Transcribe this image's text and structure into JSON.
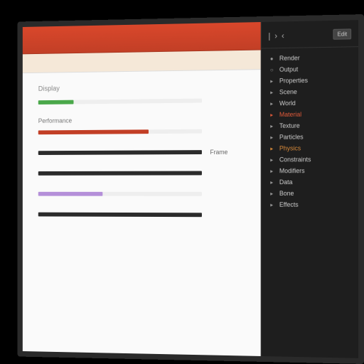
{
  "header": {
    "title": ""
  },
  "content": {
    "section1_label": "Display",
    "section2_label": "Performance",
    "rows": [
      {
        "caption": "",
        "fill_pct": 22,
        "color": "#4aa84a",
        "label": ""
      },
      {
        "caption": "",
        "fill_pct": 68,
        "color": "#c23f26",
        "label": ""
      },
      {
        "caption": "",
        "fill_pct": 100,
        "color": "#2b2b2b",
        "label": "Frame"
      },
      {
        "caption": "",
        "fill_pct": 100,
        "color": "#2b2b2b",
        "label": ""
      },
      {
        "caption": "",
        "fill_pct": 40,
        "color": "#b48fd9",
        "label": ""
      },
      {
        "caption": "",
        "fill_pct": 100,
        "color": "#2b2b2b",
        "label": ""
      }
    ]
  },
  "sidebar": {
    "badge": "Edit",
    "items": [
      {
        "icon": "●",
        "label": "Render",
        "accent": ""
      },
      {
        "icon": "○",
        "label": "Output",
        "accent": ""
      },
      {
        "icon": "▸",
        "label": "Properties",
        "accent": ""
      },
      {
        "icon": "▸",
        "label": "Scene",
        "accent": ""
      },
      {
        "icon": "▸",
        "label": "World",
        "accent": ""
      },
      {
        "icon": "▸",
        "label": "Material",
        "accent": "accent-red"
      },
      {
        "icon": "▸",
        "label": "Texture",
        "accent": ""
      },
      {
        "icon": "▸",
        "label": "Particles",
        "accent": ""
      },
      {
        "icon": "▸",
        "label": "Physics",
        "accent": "accent-orange"
      },
      {
        "icon": "▸",
        "label": "Constraints",
        "accent": ""
      },
      {
        "icon": "▸",
        "label": "Modifiers",
        "accent": ""
      },
      {
        "icon": "▸",
        "label": "Data",
        "accent": ""
      },
      {
        "icon": "▸",
        "label": "Bone",
        "accent": ""
      },
      {
        "icon": "▸",
        "label": "Effects",
        "accent": ""
      }
    ]
  }
}
